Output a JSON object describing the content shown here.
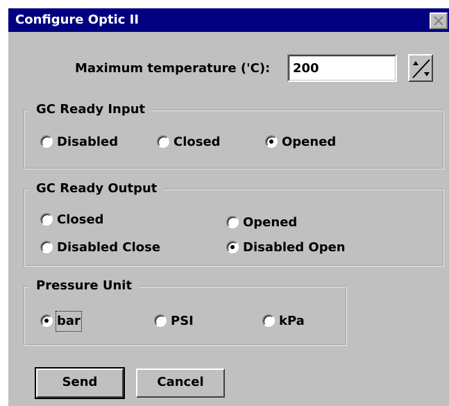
{
  "window": {
    "title": "Configure Optic II",
    "close_icon": "close-x-icon"
  },
  "max_temp": {
    "label": "Maximum temperature ('C):",
    "value": "200",
    "spin_icon": "spin-updown-icon"
  },
  "gc_ready_input": {
    "legend": "GC Ready Input",
    "options": [
      {
        "label": "Disabled",
        "checked": false
      },
      {
        "label": "Closed",
        "checked": false
      },
      {
        "label": "Opened",
        "checked": true
      }
    ]
  },
  "gc_ready_output": {
    "legend": "GC Ready Output",
    "options": [
      {
        "label": "Closed",
        "checked": false
      },
      {
        "label": "Opened",
        "checked": false
      },
      {
        "label": "Disabled Close",
        "checked": false
      },
      {
        "label": "Disabled Open",
        "checked": true
      }
    ]
  },
  "pressure_unit": {
    "legend": "Pressure Unit",
    "options": [
      {
        "label": "bar",
        "checked": true
      },
      {
        "label": "PSI",
        "checked": false
      },
      {
        "label": "kPa",
        "checked": false
      }
    ]
  },
  "buttons": {
    "send": "Send",
    "cancel": "Cancel"
  }
}
